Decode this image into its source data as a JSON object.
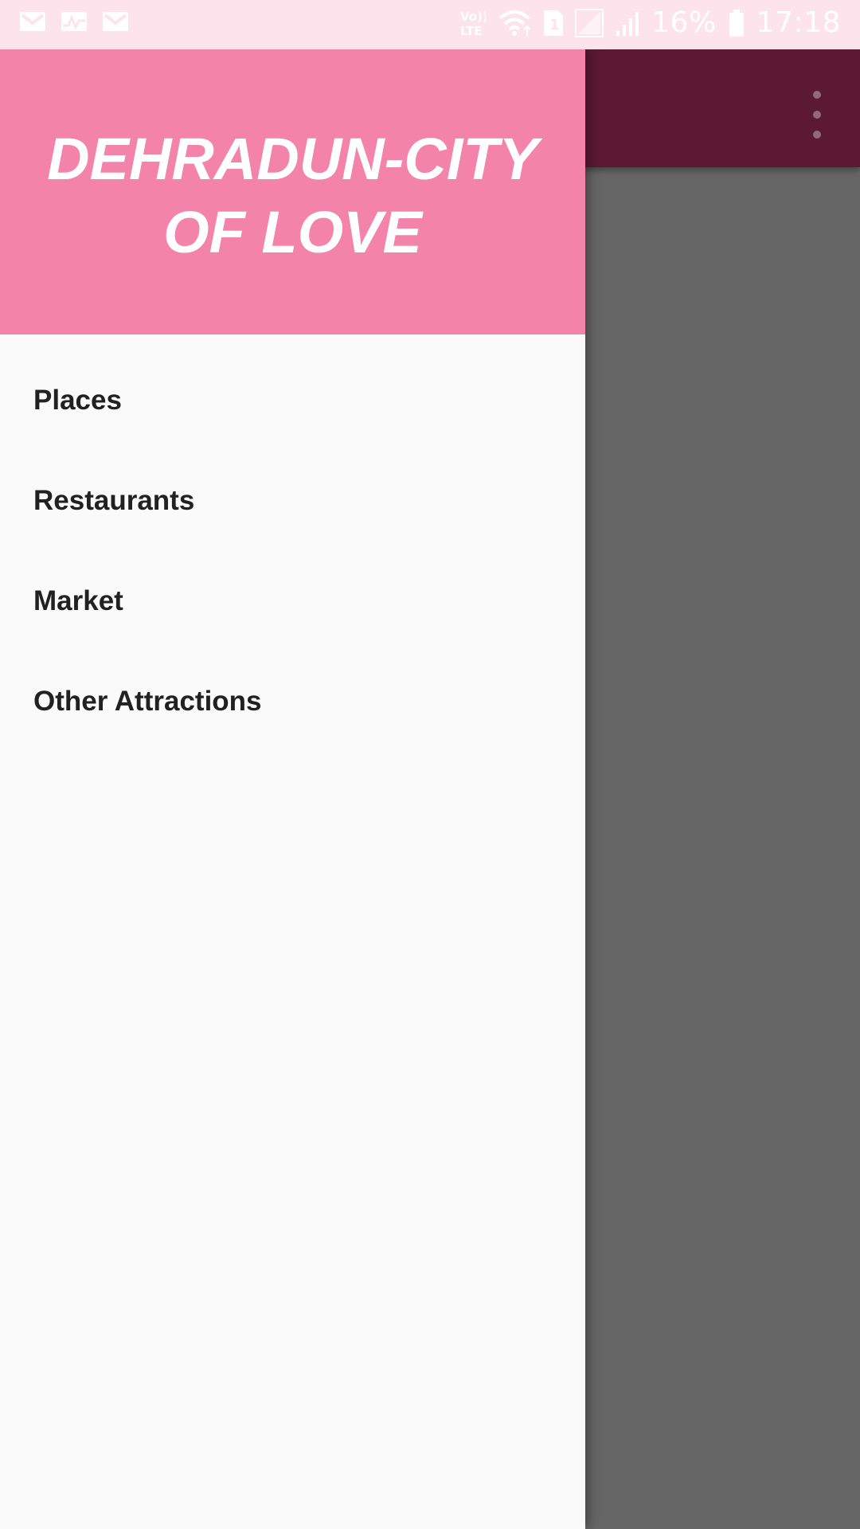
{
  "status_bar": {
    "left_icons": [
      "gmail-icon",
      "activity-icon",
      "gmail-icon"
    ],
    "right_icons": [
      "volte-icon",
      "wifi-icon",
      "sim-1-icon",
      "signal-sim1-icon",
      "signal-sim2-icon",
      "battery-icon"
    ],
    "volte_label": "Vo)) LTE",
    "sim_label": "1",
    "battery_percent": "16%",
    "time": "17:18"
  },
  "app_bar": {
    "color": "#5b1a31",
    "menu_icon": "overflow-menu-icon"
  },
  "drawer": {
    "header_color": "#f383a8",
    "title": "DEHRADUN-CITY OF LOVE",
    "items": [
      {
        "label": "Places"
      },
      {
        "label": "Restaurants"
      },
      {
        "label": "Market"
      },
      {
        "label": "Other Attractions"
      }
    ]
  }
}
